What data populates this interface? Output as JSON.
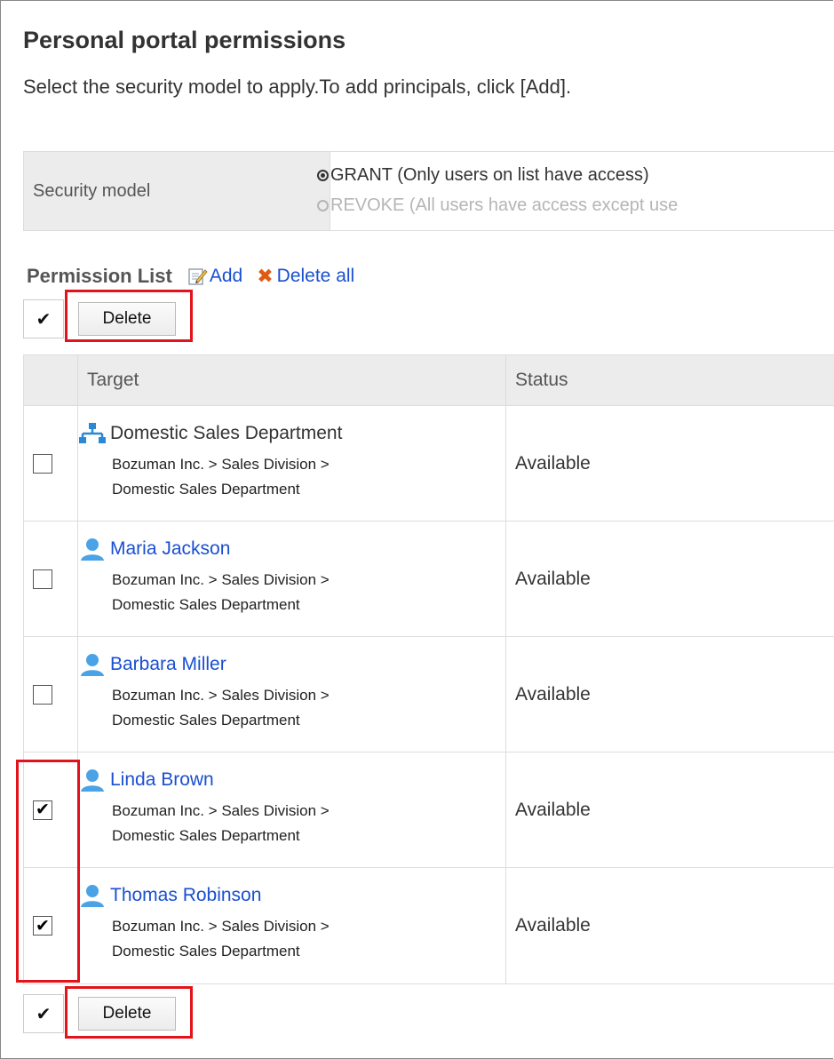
{
  "page": {
    "title": "Personal portal permissions",
    "instruction": "Select the security model to apply.To add principals, click [Add]."
  },
  "security_model": {
    "label": "Security model",
    "options": [
      {
        "label": "GRANT (Only users on list have access)",
        "selected": true
      },
      {
        "label": "REVOKE (All users have access except use",
        "selected": false
      }
    ]
  },
  "permission_list": {
    "title": "Permission List",
    "add_label": "Add",
    "delete_all_label": "Delete all",
    "check_all_glyph": "✔",
    "delete_label": "Delete",
    "columns": [
      "Target",
      "Status"
    ],
    "rows": [
      {
        "icon": "organization-icon",
        "name": "Domestic Sales Department",
        "is_link": false,
        "path1": "Bozuman Inc. > Sales Division >",
        "path2": "Domestic Sales Department",
        "status": "Available",
        "checked": false
      },
      {
        "icon": "user-icon",
        "name": "Maria Jackson",
        "is_link": true,
        "path1": "Bozuman Inc. > Sales Division >",
        "path2": "Domestic Sales Department",
        "status": "Available",
        "checked": false
      },
      {
        "icon": "user-icon",
        "name": "Barbara Miller",
        "is_link": true,
        "path1": "Bozuman Inc. > Sales Division >",
        "path2": "Domestic Sales Department",
        "status": "Available",
        "checked": false
      },
      {
        "icon": "user-icon",
        "name": "Linda Brown",
        "is_link": true,
        "path1": "Bozuman Inc. > Sales Division >",
        "path2": "Domestic Sales Department",
        "status": "Available",
        "checked": true
      },
      {
        "icon": "user-icon",
        "name": "Thomas Robinson",
        "is_link": true,
        "path1": "Bozuman Inc. > Sales Division >",
        "path2": "Domestic Sales Department",
        "status": "Available",
        "checked": true
      }
    ]
  },
  "colors": {
    "link": "#1a4fd0",
    "highlight": "#e3131b",
    "header_bg": "#ececec",
    "delete_all_icon": "#e05a17",
    "user_icon": "#4aa3e6",
    "org_icon": "#2a88d6"
  }
}
